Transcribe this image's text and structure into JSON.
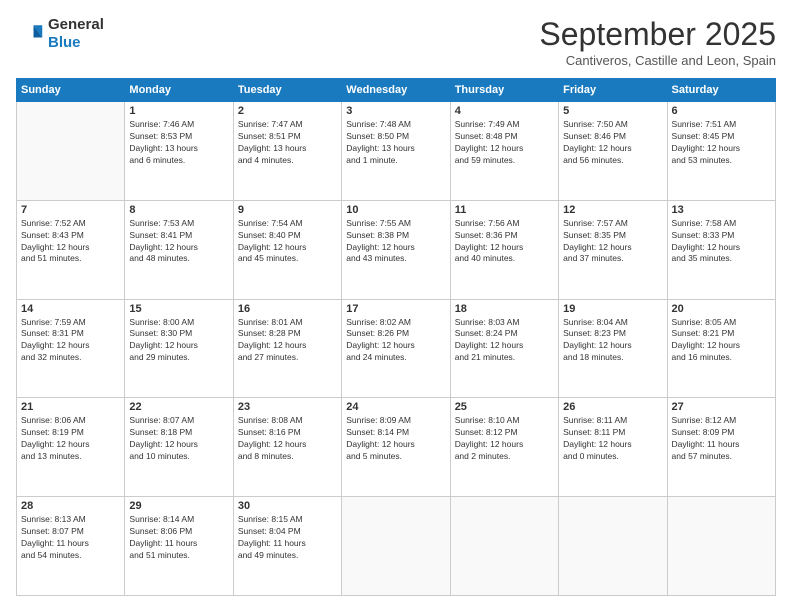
{
  "logo": {
    "line1": "General",
    "line2": "Blue"
  },
  "title": "September 2025",
  "subtitle": "Cantiveros, Castille and Leon, Spain",
  "headers": [
    "Sunday",
    "Monday",
    "Tuesday",
    "Wednesday",
    "Thursday",
    "Friday",
    "Saturday"
  ],
  "weeks": [
    [
      {
        "day": "",
        "info": ""
      },
      {
        "day": "1",
        "info": "Sunrise: 7:46 AM\nSunset: 8:53 PM\nDaylight: 13 hours\nand 6 minutes."
      },
      {
        "day": "2",
        "info": "Sunrise: 7:47 AM\nSunset: 8:51 PM\nDaylight: 13 hours\nand 4 minutes."
      },
      {
        "day": "3",
        "info": "Sunrise: 7:48 AM\nSunset: 8:50 PM\nDaylight: 13 hours\nand 1 minute."
      },
      {
        "day": "4",
        "info": "Sunrise: 7:49 AM\nSunset: 8:48 PM\nDaylight: 12 hours\nand 59 minutes."
      },
      {
        "day": "5",
        "info": "Sunrise: 7:50 AM\nSunset: 8:46 PM\nDaylight: 12 hours\nand 56 minutes."
      },
      {
        "day": "6",
        "info": "Sunrise: 7:51 AM\nSunset: 8:45 PM\nDaylight: 12 hours\nand 53 minutes."
      }
    ],
    [
      {
        "day": "7",
        "info": "Sunrise: 7:52 AM\nSunset: 8:43 PM\nDaylight: 12 hours\nand 51 minutes."
      },
      {
        "day": "8",
        "info": "Sunrise: 7:53 AM\nSunset: 8:41 PM\nDaylight: 12 hours\nand 48 minutes."
      },
      {
        "day": "9",
        "info": "Sunrise: 7:54 AM\nSunset: 8:40 PM\nDaylight: 12 hours\nand 45 minutes."
      },
      {
        "day": "10",
        "info": "Sunrise: 7:55 AM\nSunset: 8:38 PM\nDaylight: 12 hours\nand 43 minutes."
      },
      {
        "day": "11",
        "info": "Sunrise: 7:56 AM\nSunset: 8:36 PM\nDaylight: 12 hours\nand 40 minutes."
      },
      {
        "day": "12",
        "info": "Sunrise: 7:57 AM\nSunset: 8:35 PM\nDaylight: 12 hours\nand 37 minutes."
      },
      {
        "day": "13",
        "info": "Sunrise: 7:58 AM\nSunset: 8:33 PM\nDaylight: 12 hours\nand 35 minutes."
      }
    ],
    [
      {
        "day": "14",
        "info": "Sunrise: 7:59 AM\nSunset: 8:31 PM\nDaylight: 12 hours\nand 32 minutes."
      },
      {
        "day": "15",
        "info": "Sunrise: 8:00 AM\nSunset: 8:30 PM\nDaylight: 12 hours\nand 29 minutes."
      },
      {
        "day": "16",
        "info": "Sunrise: 8:01 AM\nSunset: 8:28 PM\nDaylight: 12 hours\nand 27 minutes."
      },
      {
        "day": "17",
        "info": "Sunrise: 8:02 AM\nSunset: 8:26 PM\nDaylight: 12 hours\nand 24 minutes."
      },
      {
        "day": "18",
        "info": "Sunrise: 8:03 AM\nSunset: 8:24 PM\nDaylight: 12 hours\nand 21 minutes."
      },
      {
        "day": "19",
        "info": "Sunrise: 8:04 AM\nSunset: 8:23 PM\nDaylight: 12 hours\nand 18 minutes."
      },
      {
        "day": "20",
        "info": "Sunrise: 8:05 AM\nSunset: 8:21 PM\nDaylight: 12 hours\nand 16 minutes."
      }
    ],
    [
      {
        "day": "21",
        "info": "Sunrise: 8:06 AM\nSunset: 8:19 PM\nDaylight: 12 hours\nand 13 minutes."
      },
      {
        "day": "22",
        "info": "Sunrise: 8:07 AM\nSunset: 8:18 PM\nDaylight: 12 hours\nand 10 minutes."
      },
      {
        "day": "23",
        "info": "Sunrise: 8:08 AM\nSunset: 8:16 PM\nDaylight: 12 hours\nand 8 minutes."
      },
      {
        "day": "24",
        "info": "Sunrise: 8:09 AM\nSunset: 8:14 PM\nDaylight: 12 hours\nand 5 minutes."
      },
      {
        "day": "25",
        "info": "Sunrise: 8:10 AM\nSunset: 8:12 PM\nDaylight: 12 hours\nand 2 minutes."
      },
      {
        "day": "26",
        "info": "Sunrise: 8:11 AM\nSunset: 8:11 PM\nDaylight: 12 hours\nand 0 minutes."
      },
      {
        "day": "27",
        "info": "Sunrise: 8:12 AM\nSunset: 8:09 PM\nDaylight: 11 hours\nand 57 minutes."
      }
    ],
    [
      {
        "day": "28",
        "info": "Sunrise: 8:13 AM\nSunset: 8:07 PM\nDaylight: 11 hours\nand 54 minutes."
      },
      {
        "day": "29",
        "info": "Sunrise: 8:14 AM\nSunset: 8:06 PM\nDaylight: 11 hours\nand 51 minutes."
      },
      {
        "day": "30",
        "info": "Sunrise: 8:15 AM\nSunset: 8:04 PM\nDaylight: 11 hours\nand 49 minutes."
      },
      {
        "day": "",
        "info": ""
      },
      {
        "day": "",
        "info": ""
      },
      {
        "day": "",
        "info": ""
      },
      {
        "day": "",
        "info": ""
      }
    ]
  ]
}
